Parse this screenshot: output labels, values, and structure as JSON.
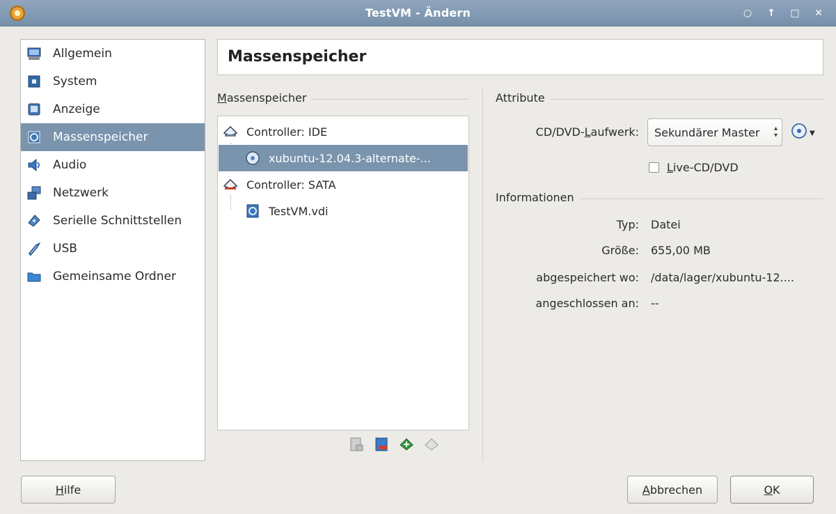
{
  "window": {
    "title": "TestVM - Ändern",
    "controls": [
      "○",
      "↑",
      "□",
      "✕"
    ]
  },
  "sidebar": {
    "items": [
      {
        "label": "Allgemein",
        "icon": "monitor-icon",
        "selected": false
      },
      {
        "label": "System",
        "icon": "chip-icon",
        "selected": false
      },
      {
        "label": "Anzeige",
        "icon": "display-icon",
        "selected": false
      },
      {
        "label": "Massenspeicher",
        "icon": "storage-icon",
        "selected": true
      },
      {
        "label": "Audio",
        "icon": "speaker-icon",
        "selected": false
      },
      {
        "label": "Netzwerk",
        "icon": "network-icon",
        "selected": false
      },
      {
        "label": "Serielle Schnittstellen",
        "icon": "serial-port-icon",
        "selected": false
      },
      {
        "label": "USB",
        "icon": "usb-icon",
        "selected": false
      },
      {
        "label": "Gemeinsame Ordner",
        "icon": "folder-icon",
        "selected": false
      }
    ]
  },
  "header": {
    "title": "Massenspeicher"
  },
  "storage": {
    "group_label_prefix": "M",
    "group_label_rest": "assenspeicher",
    "tree": [
      {
        "label": "Controller: IDE",
        "icon": "ide-controller-icon",
        "level": 0,
        "selected": false
      },
      {
        "label": "xubuntu-12.04.3-alternate-...",
        "icon": "optical-disc-icon",
        "level": 1,
        "selected": true
      },
      {
        "label": "Controller: SATA",
        "icon": "sata-controller-icon",
        "level": 0,
        "selected": false
      },
      {
        "label": "TestVM.vdi",
        "icon": "hard-disk-icon",
        "level": 1,
        "selected": false
      }
    ],
    "toolbar": [
      "remove-attachment-icon",
      "add-attachment-icon",
      "add-controller-icon",
      "remove-controller-icon"
    ]
  },
  "attributes": {
    "group_label": "Attribute",
    "drive_label_pre": "CD/DVD-",
    "drive_label_key": "L",
    "drive_label_post": "aufwerk:",
    "drive_value": "Sekundärer Master",
    "live_cd_key": "L",
    "live_cd_rest": "ive-CD/DVD",
    "live_cd_checked": false
  },
  "information": {
    "group_label": "Informationen",
    "rows": [
      {
        "label": "Typ:",
        "value": "Datei"
      },
      {
        "label": "Größe:",
        "value": "655,00 MB"
      },
      {
        "label": "abgespeichert wo:",
        "value": "/data/lager/xubuntu-12...."
      },
      {
        "label": "angeschlossen an:",
        "value": "--"
      }
    ]
  },
  "buttons": {
    "help_key": "H",
    "help_rest": "ilfe",
    "cancel_key": "A",
    "cancel_rest": "bbrechen",
    "ok_key": "O",
    "ok_rest": "K"
  },
  "colors": {
    "selection": "#7b94ad",
    "titlebar": "#7f98b2"
  }
}
